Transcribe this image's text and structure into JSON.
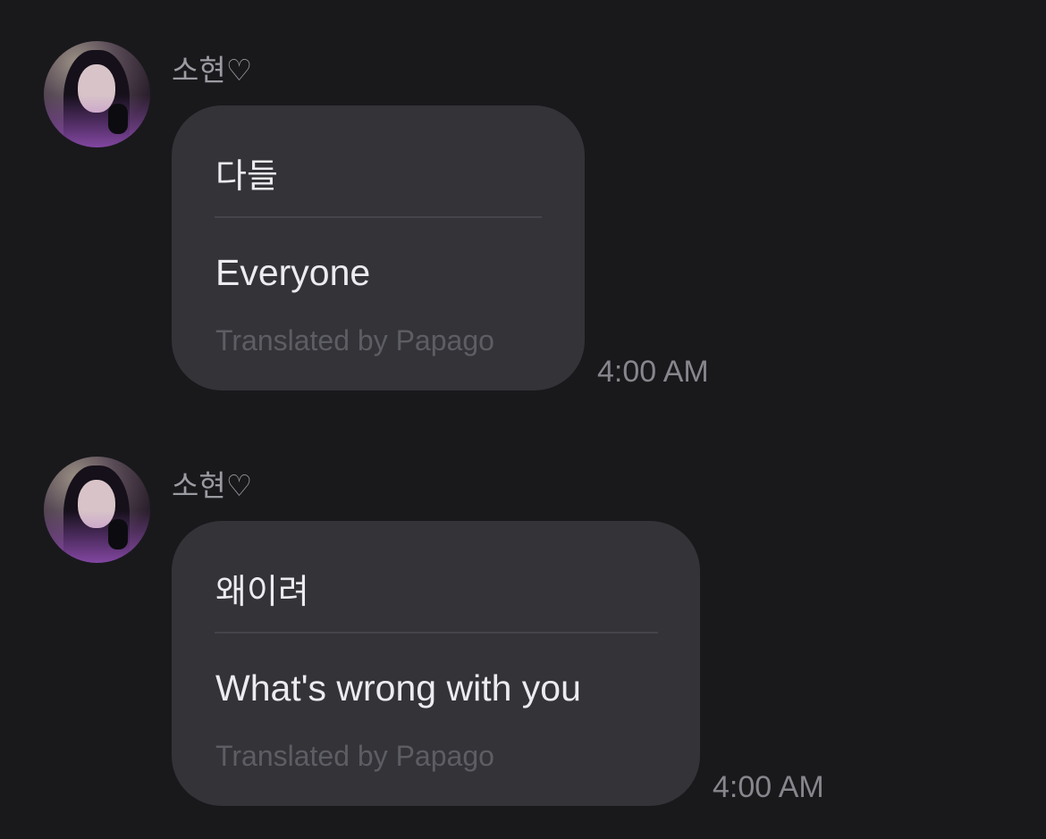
{
  "messages": [
    {
      "sender": "소현♡",
      "original": "다들",
      "translation": "Everyone",
      "credit": "Translated by Papago",
      "time": "4:00 AM"
    },
    {
      "sender": "소현♡",
      "original": "왜이려",
      "translation": "What's wrong with you",
      "credit": "Translated by Papago",
      "time": "4:00 AM"
    }
  ],
  "colors": {
    "background": "#19191c",
    "bubble": "#333338",
    "text": "#ececf0",
    "muted": "#86868c"
  }
}
